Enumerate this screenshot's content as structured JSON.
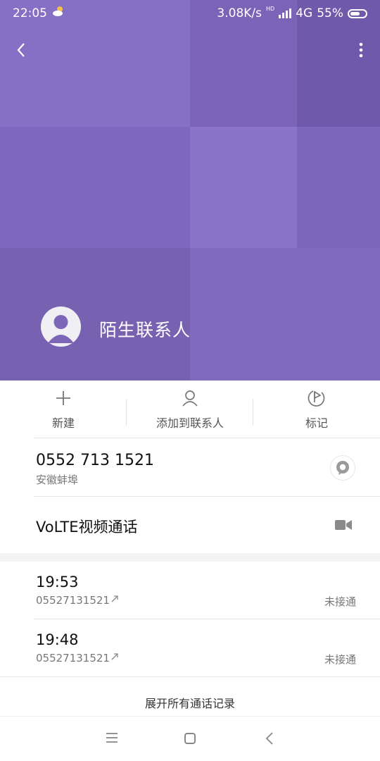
{
  "status_bar": {
    "time": "22:05",
    "speed": "3.08K/s",
    "hd": "HD",
    "network": "4G",
    "battery": "55%"
  },
  "contact": {
    "name": "陌生联系人"
  },
  "actions": [
    {
      "label": "新建",
      "icon": "plus-icon"
    },
    {
      "label": "添加到联系人",
      "icon": "person-icon"
    },
    {
      "label": "标记",
      "icon": "flag-icon"
    }
  ],
  "phone": {
    "number": "0552 713 1521",
    "location": "安徽蚌埠"
  },
  "volte": {
    "label": "VoLTE视频通话"
  },
  "call_log": [
    {
      "time": "19:53",
      "number": "05527131521",
      "status": "未接通"
    },
    {
      "time": "19:48",
      "number": "05527131521",
      "status": "未接通"
    }
  ],
  "expand_label": "展开所有通话记录",
  "colors": {
    "header": "#7b66b8",
    "icon_gray": "#777777"
  }
}
